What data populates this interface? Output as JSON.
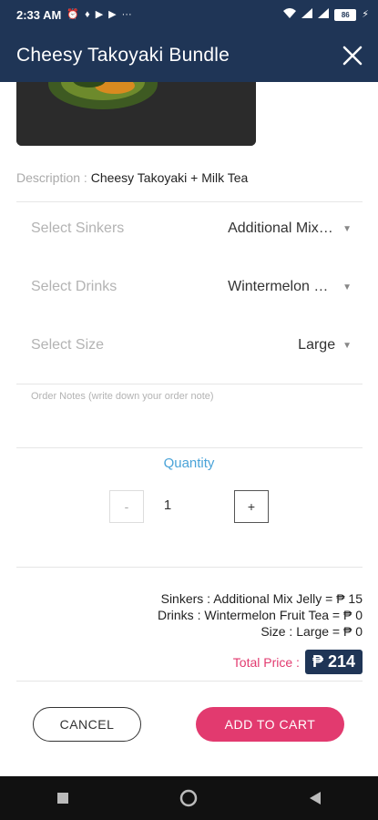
{
  "status_bar": {
    "time": "2:33 AM",
    "battery": "86",
    "icons": [
      "alarm-icon",
      "notification-icon",
      "youtube-icon",
      "youtube-icon",
      "more-icon",
      "wifi-icon",
      "signal-icon",
      "signal-icon",
      "battery-icon",
      "charging-icon"
    ]
  },
  "header": {
    "title": "Cheesy Takoyaki Bundle",
    "close_icon": "close-icon"
  },
  "description": {
    "label": "Description : ",
    "value": "Cheesy Takoyaki + Milk Tea"
  },
  "selects": {
    "sinkers": {
      "label": "Select Sinkers",
      "value": "Additional Mix Jelly"
    },
    "drinks": {
      "label": "Select Drinks",
      "value": "Wintermelon Fruit Tea"
    },
    "size": {
      "label": "Select Size",
      "value": "Large"
    }
  },
  "notes": {
    "placeholder": "Order Notes (write down your order note)",
    "value": ""
  },
  "quantity": {
    "label": "Quantity",
    "value": "1",
    "minus": "-",
    "plus": "+"
  },
  "summary": {
    "sinkers": "Sinkers : Additional Mix Jelly = ₱ 15",
    "drinks": "Drinks : Wintermelon Fruit Tea = ₱ 0",
    "size": "Size : Large = ₱ 0"
  },
  "total": {
    "label": "Total Price :",
    "currency": "₱",
    "amount": "214"
  },
  "actions": {
    "cancel": "CANCEL",
    "add_to_cart": "ADD TO CART"
  },
  "colors": {
    "header_bg": "#1f3556",
    "accent_pink": "#e23a6f",
    "quantity_blue": "#4aa3d8"
  }
}
